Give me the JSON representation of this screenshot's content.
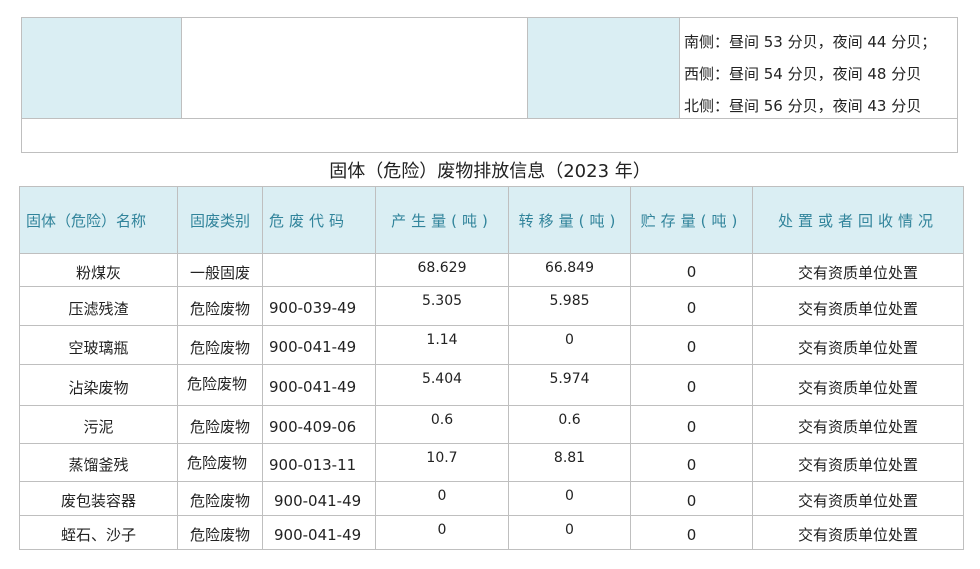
{
  "noise": {
    "lines": [
      "南侧：昼间 53 分贝，夜间 44 分贝；",
      "西侧：昼间 54 分贝，夜间 48 分贝",
      "北侧：昼间 56 分贝，夜间 43 分贝"
    ]
  },
  "solid_waste": {
    "title": "固体（危险）废物排放信息（2023 年）",
    "headers": [
      "固体（危险）名称",
      "固废类别",
      "危废代码",
      "产生量(吨)",
      "转移量(吨)",
      "贮存量(吨)",
      "处置或者回收情况"
    ],
    "rows": [
      {
        "name": "粉煤灰",
        "category": "一般固废",
        "code": "",
        "produced": "68.629",
        "transferred": "66.849",
        "stored": "0",
        "disposal": "交有资质单位处置"
      },
      {
        "name": "压滤残渣",
        "category": "危险废物",
        "code": "900-039-49",
        "produced": "5.305",
        "transferred": "5.985",
        "stored": "0",
        "disposal": "交有资质单位处置"
      },
      {
        "name": "空玻璃瓶",
        "category": "危险废物",
        "code": "900-041-49",
        "produced": "1.14",
        "transferred": "0",
        "stored": "0",
        "disposal": "交有资质单位处置"
      },
      {
        "name": "沾染废物",
        "category": "危险废物",
        "code": "900-041-49",
        "produced": "5.404",
        "transferred": "5.974",
        "stored": "0",
        "disposal": "交有资质单位处置"
      },
      {
        "name": "污泥",
        "category": "危险废物",
        "code": "900-409-06",
        "produced": "0.6",
        "transferred": "0.6",
        "stored": "0",
        "disposal": "交有资质单位处置"
      },
      {
        "name": "蒸馏釜残",
        "category": "危险废物",
        "code": "900-013-11",
        "produced": "10.7",
        "transferred": "8.81",
        "stored": "0",
        "disposal": "交有资质单位处置"
      },
      {
        "name": "废包装容器",
        "category": "危险废物",
        "code": "900-041-49",
        "produced": "0",
        "transferred": "0",
        "stored": "0",
        "disposal": "交有资质单位处置"
      },
      {
        "name": "蛭石、沙子",
        "category": "危险废物",
        "code": "900-041-49",
        "produced": "0",
        "transferred": "0",
        "stored": "0",
        "disposal": "交有资质单位处置"
      }
    ]
  }
}
